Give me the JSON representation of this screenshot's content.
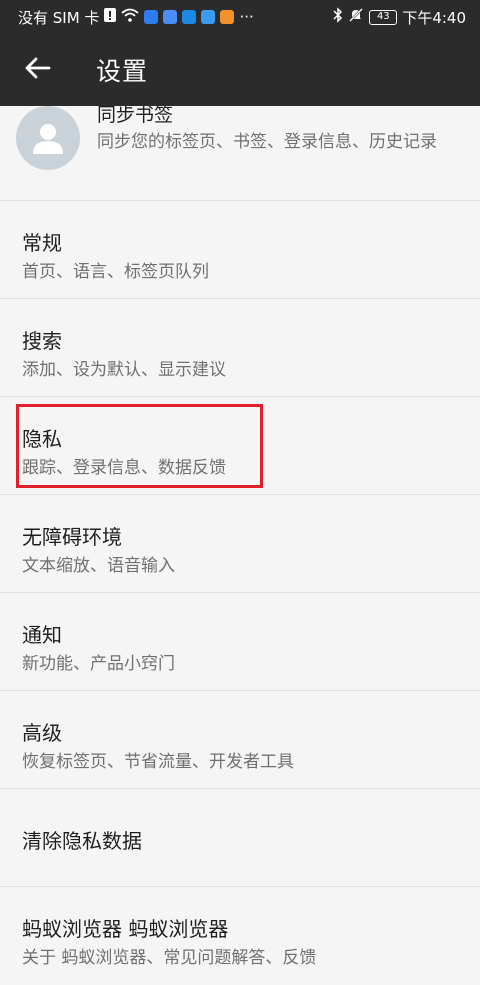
{
  "status_bar": {
    "carrier": "没有 SIM 卡",
    "battery": "43",
    "time": "下午4:40",
    "icons": [
      "alert-icon",
      "wifi-icon",
      "app-bulb-icon",
      "app-music-icon",
      "app-cloud-icon",
      "app-weather-icon",
      "app-play-icon",
      "more-dots-icon",
      "bluetooth-icon",
      "mute-icon",
      "battery-icon"
    ],
    "more": "···"
  },
  "app_bar": {
    "back_icon": "arrow-left-icon",
    "title": "设置"
  },
  "sync": {
    "title": "同步书签",
    "subtitle": "同步您的标签页、书签、登录信息、历史记录"
  },
  "settings": [
    {
      "title": "常规",
      "subtitle": "首页、语言、标签页队列"
    },
    {
      "title": "搜索",
      "subtitle": "添加、设为默认、显示建议"
    },
    {
      "title": "隐私",
      "subtitle": "跟踪、登录信息、数据反馈"
    },
    {
      "title": "无障碍环境",
      "subtitle": "文本缩放、语音输入"
    },
    {
      "title": "通知",
      "subtitle": "新功能、产品小窍门"
    },
    {
      "title": "高级",
      "subtitle": "恢复标签页、节省流量、开发者工具"
    },
    {
      "title": "清除隐私数据",
      "subtitle": ""
    },
    {
      "title": "蚂蚁浏览器 蚂蚁浏览器",
      "subtitle": "关于 蚂蚁浏览器、常见问题解答、反馈"
    }
  ],
  "colors": {
    "bar_bg": "#2b2b2b",
    "highlight": "#e0202a"
  }
}
